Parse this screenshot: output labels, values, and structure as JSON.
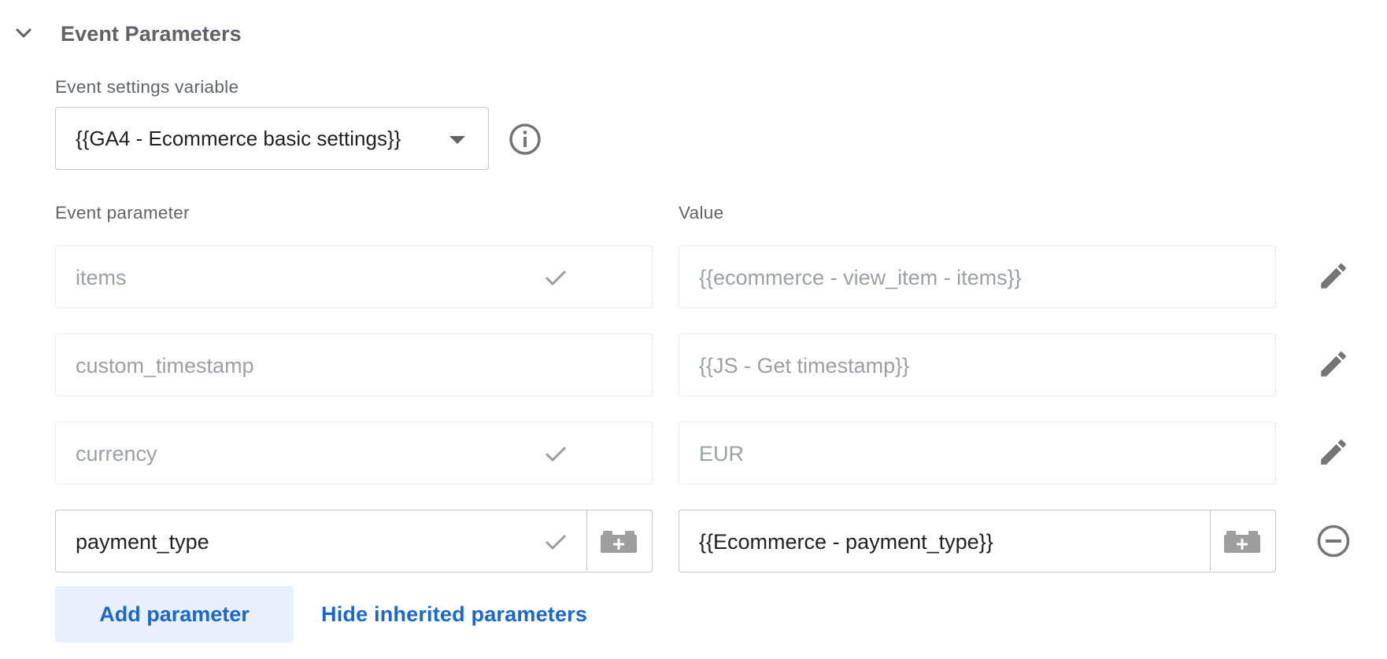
{
  "section": {
    "title": "Event Parameters"
  },
  "event_settings": {
    "label": "Event settings variable",
    "selected_value": "{{GA4 - Ecommerce basic settings}}"
  },
  "columns": {
    "parameter": "Event parameter",
    "value": "Value"
  },
  "rows": [
    {
      "parameter": "items",
      "value": "{{ecommerce - view_item - items}}",
      "checked": true,
      "inherited": true
    },
    {
      "parameter": "custom_timestamp",
      "value": "{{JS - Get timestamp}}",
      "checked": false,
      "inherited": true
    },
    {
      "parameter": "currency",
      "value": "EUR",
      "checked": true,
      "inherited": true
    },
    {
      "parameter": "payment_type",
      "value": "{{Ecommerce - payment_type}}",
      "checked": true,
      "inherited": false
    }
  ],
  "actions": {
    "add_parameter": "Add parameter",
    "hide_inherited": "Hide inherited parameters"
  },
  "colors": {
    "accent": "#1967d2",
    "accent_bg": "#e8f0fe",
    "muted_text": "#9aa0a6",
    "icon": "#757575"
  },
  "icons": {
    "collapse": "chevron-down-icon",
    "info": "info-icon",
    "check": "check-icon",
    "edit": "pencil-icon",
    "variable": "brick-add-icon",
    "remove": "remove-circle-icon"
  }
}
